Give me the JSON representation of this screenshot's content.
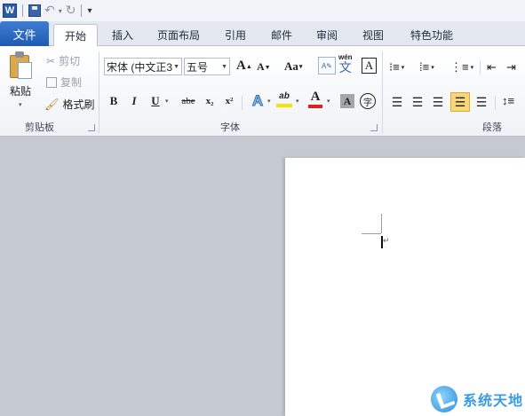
{
  "qat": {
    "app_logo": "W",
    "icons": [
      "word-logo-icon",
      "save-icon",
      "undo-icon",
      "redo-icon",
      "customize-icon"
    ]
  },
  "tabs": [
    {
      "label": "文件",
      "active": false
    },
    {
      "label": "开始",
      "active": true
    },
    {
      "label": "插入",
      "active": false
    },
    {
      "label": "页面布局",
      "active": false
    },
    {
      "label": "引用",
      "active": false
    },
    {
      "label": "邮件",
      "active": false
    },
    {
      "label": "审阅",
      "active": false
    },
    {
      "label": "视图",
      "active": false
    },
    {
      "label": "特色功能",
      "active": false
    }
  ],
  "clipboard": {
    "group_label": "剪贴板",
    "paste_label": "粘贴",
    "cut_label": "剪切",
    "copy_label": "复制",
    "format_painter_label": "格式刷"
  },
  "font": {
    "group_label": "字体",
    "font_name": "宋体 (中文正3",
    "font_size": "五号",
    "grow_font": "A",
    "shrink_font": "A",
    "change_case": "Aa",
    "pinyin": "wén",
    "pinyin_char": "文",
    "border_char": "A",
    "bold": "B",
    "italic": "I",
    "underline": "U",
    "strike": "abe",
    "subscript": "x₂",
    "superscript": "x²",
    "effects": "A",
    "highlight": "ab",
    "font_color": "A",
    "shading": "A",
    "enclose_char": "字"
  },
  "paragraph": {
    "group_label": "段落"
  },
  "colors": {
    "file_tab": "#2a62b8",
    "font_color_bar": "#e02020",
    "highlight_bar": "#f5e400",
    "justify_active": "#f9d678",
    "watermark": "#3a9be3"
  },
  "watermark": {
    "text": "系统天地"
  }
}
